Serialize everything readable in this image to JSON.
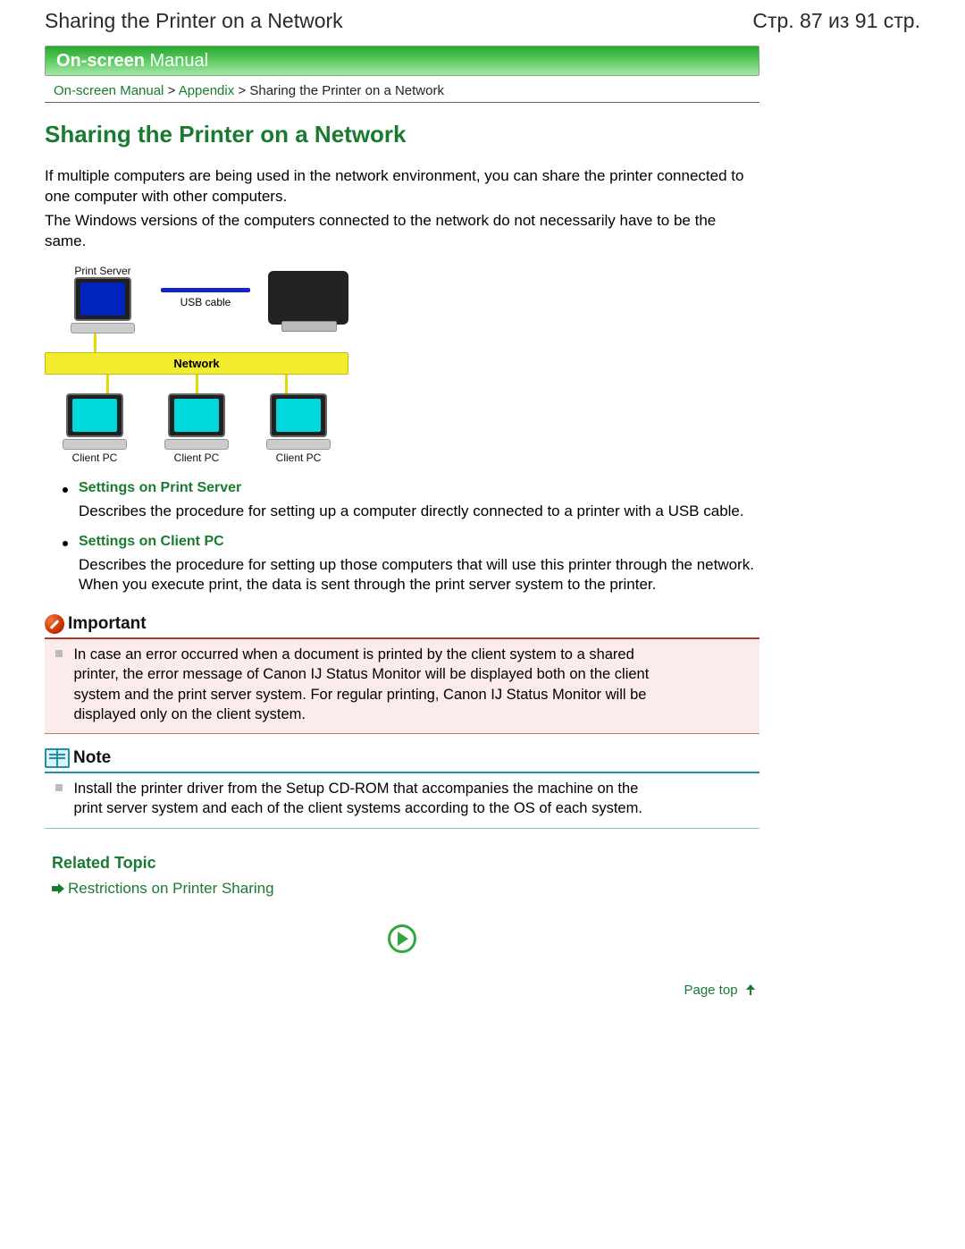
{
  "header": {
    "title": "Sharing the Printer on a Network",
    "page_counter": "Стр. 87 из 91 стр."
  },
  "banner": {
    "bold": "On-screen",
    "thin": " Manual"
  },
  "breadcrumb": {
    "items": [
      {
        "label": "On-screen Manual",
        "link": true
      },
      {
        "label": "Appendix",
        "link": true
      },
      {
        "label": "Sharing the Printer on a Network",
        "link": false
      }
    ],
    "sep": " > "
  },
  "main_title": "Sharing the Printer on a Network",
  "intro": {
    "p1": "If multiple computers are being used in the network environment, you can share the printer connected to one computer with other computers.",
    "p2": "The Windows versions of the computers connected to the network do not necessarily have to be the same."
  },
  "diagram": {
    "print_server": "Print Server",
    "usb_cable": "USB cable",
    "network": "Network",
    "client_pc": "Client PC"
  },
  "settings": [
    {
      "title": "Settings on Print Server",
      "desc": "Describes the procedure for setting up a computer directly connected to a printer with a USB cable."
    },
    {
      "title": "Settings on Client PC",
      "desc": "Describes the procedure for setting up those computers that will use this printer through the network.\nWhen you execute print, the data is sent through the print server system to the printer."
    }
  ],
  "important": {
    "label": "Important",
    "text": "In case an error occurred when a document is printed by the client system to a shared printer, the error message of Canon IJ Status Monitor will be displayed both on the client system and the print server system. For regular printing, Canon IJ Status Monitor will be displayed only on the client system."
  },
  "note": {
    "label": "Note",
    "text": "Install the printer driver from the Setup CD-ROM that accompanies the machine on the print server system and each of the client systems according to the OS of each system."
  },
  "related": {
    "title": "Related Topic",
    "link": "Restrictions on Printer Sharing"
  },
  "page_top": "Page top"
}
